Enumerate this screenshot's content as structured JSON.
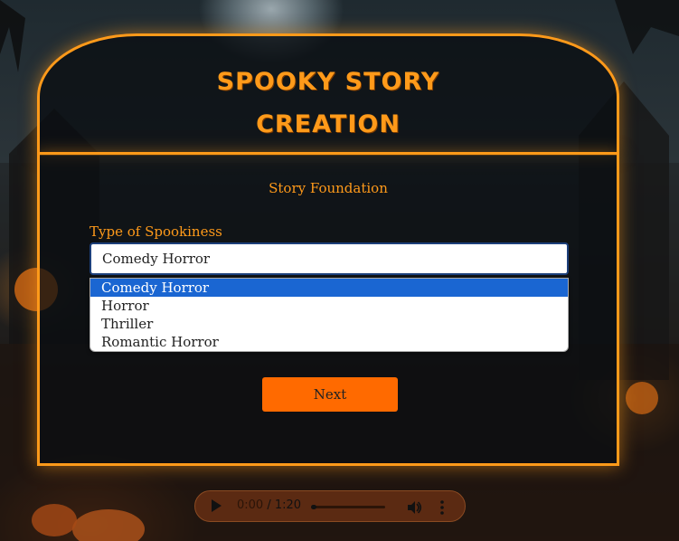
{
  "header": {
    "title_line1": "SPOOKY STORY",
    "title_line2": "CREATION"
  },
  "form": {
    "section_title": "Story Foundation",
    "field_label": "Type of Spookiness",
    "selected_value": "Comedy Horror",
    "options": [
      "Comedy Horror",
      "Horror",
      "Thriller",
      "Romantic Horror"
    ],
    "next_label": "Next"
  },
  "audio": {
    "current_time": "0:00",
    "separator": " / ",
    "duration": "1:20",
    "play_icon": "play-icon",
    "volume_icon": "volume-icon",
    "more_icon": "more-vertical-icon"
  },
  "colors": {
    "accent": "#ff9a1a",
    "button": "#ff6a00",
    "option_highlight": "#1a66d2"
  }
}
